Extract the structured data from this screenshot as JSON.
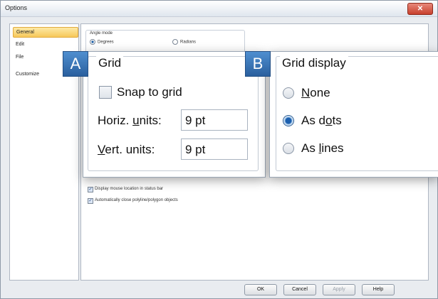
{
  "window": {
    "title": "Options",
    "close_glyph": "✕"
  },
  "nav": {
    "items": [
      {
        "label": "General",
        "selected": true
      },
      {
        "label": "Edit",
        "selected": false
      },
      {
        "label": "File",
        "selected": false
      },
      {
        "label": "Customize",
        "selected": false
      }
    ]
  },
  "general": {
    "angle_mode": {
      "label": "Angle mode",
      "options": [
        "Degrees",
        "Radians"
      ],
      "selected": "Degrees"
    },
    "display_mouse_location": {
      "label": "Display mouse location in status bar",
      "checked": true
    },
    "auto_close": {
      "label": "Automatically close polyline/polygon objects",
      "checked": true
    }
  },
  "buttons": {
    "ok": "OK",
    "cancel": "Cancel",
    "apply": "Apply",
    "help": "Help"
  },
  "callout_a": {
    "letter": "A",
    "group_title": "Grid",
    "snap": {
      "before": "Snap to ",
      "underlined": "g",
      "after": "rid",
      "checked": false
    },
    "horiz": {
      "before": "Horiz. ",
      "underlined": "u",
      "after": "nits:",
      "value": "9 pt"
    },
    "vert": {
      "before": "",
      "underlined": "V",
      "after": "ert. units:",
      "value": "9 pt"
    }
  },
  "callout_b": {
    "letter": "B",
    "group_title": "Grid display",
    "options": [
      {
        "before": "",
        "underlined": "N",
        "after": "one",
        "selected": false
      },
      {
        "before": "As d",
        "underlined": "o",
        "after": "ts",
        "selected": true
      },
      {
        "before": "As ",
        "underlined": "l",
        "after": "ines",
        "selected": false
      }
    ]
  },
  "colors": {
    "accent": "#2a5f9e",
    "selection": "#f7c85a",
    "close": "#c7402d"
  }
}
